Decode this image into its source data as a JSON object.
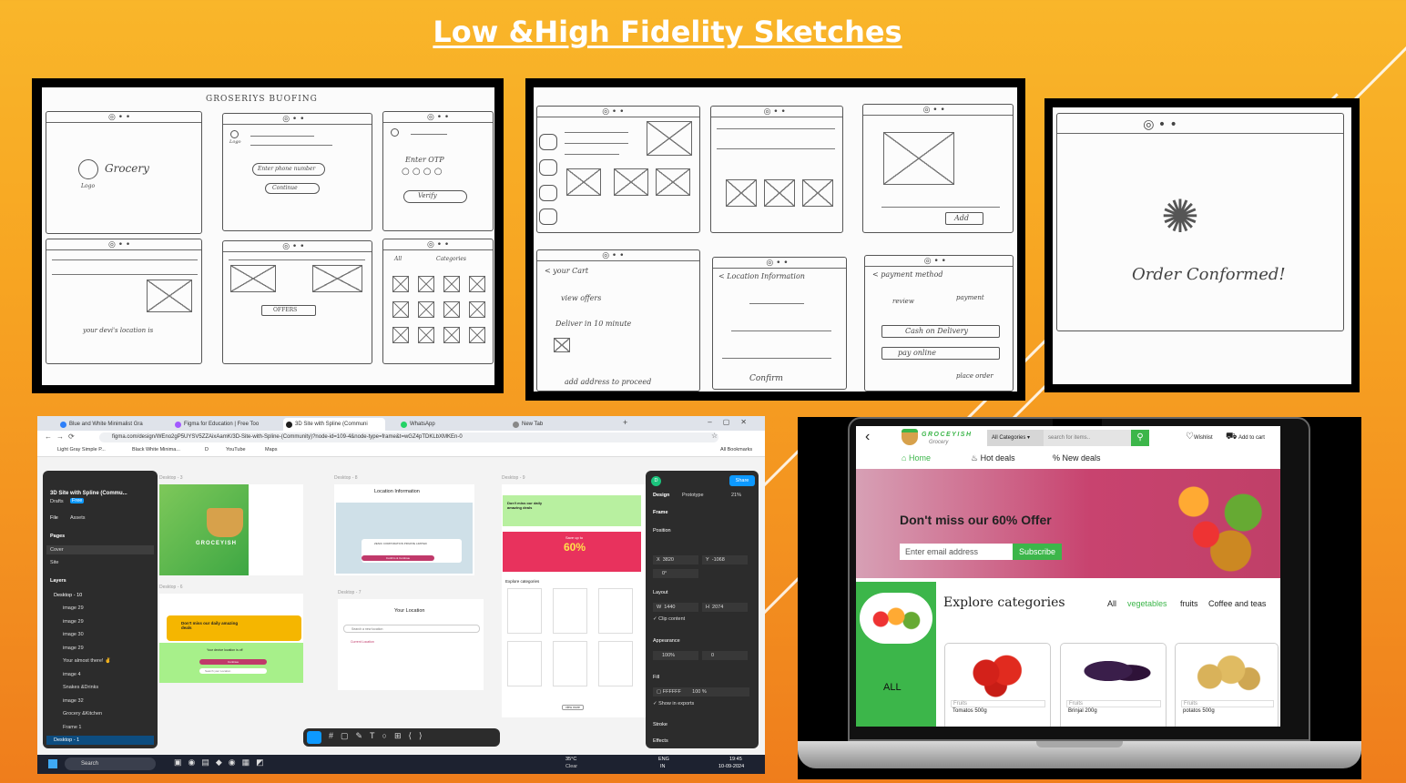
{
  "slide": {
    "title": "Low &High Fidelity Sketches"
  },
  "sketch1": {
    "header": "GROSERIYS BUOFING",
    "grocery": "Grocery",
    "logo": "Logo",
    "logo2": "Logo",
    "phone": "Enter phone number",
    "continue": "Continue",
    "otp": "Enter OTP",
    "verify": "Verify",
    "offers": "OFFERS",
    "location": "your devi's location is",
    "all": "All",
    "categories": "Categories"
  },
  "sketch2": {
    "your_cart": "< your Cart",
    "view_offers": "view offers",
    "deliver": "Deliver in 10 minute",
    "add_address": "add address to proceed",
    "location_info": "< Location Information",
    "confirm": "Confirm",
    "add": "Add",
    "payment": "< payment method",
    "review": "review",
    "payment2": "payment",
    "cash": "Cash on Delivery",
    "pay_online": "pay online",
    "place_order": "place order"
  },
  "sketch3": {
    "order": "Order Conformed!"
  },
  "figma": {
    "tabs": [
      "Blue and White Minimalist Gra",
      "Figma for Education | Free Too",
      "3D Site with Spline (Communi",
      "WhatsApp",
      "New Tab"
    ],
    "url": "figma.com/design/WEno2gP5UYSV5ZZAixAamK/3D-Site-with-Spline-(Community)?node-id=109-4&node-type=frame&t=wGZ4pTDKLbXMKEn-0",
    "bookmarks": [
      "Light Gray Simple P...",
      "Black White Minima...",
      "D",
      "YouTube",
      "Maps"
    ],
    "all_bookmarks": "All Bookmarks",
    "file_name": "3D Site with Spline (Commu...",
    "drafts": "Drafts",
    "free": "Free",
    "file": "File",
    "assets": "Assets",
    "pages": "Pages",
    "page_items": [
      "Cover",
      "Site"
    ],
    "layers": "Layers",
    "layer_items": [
      "Desktop - 10",
      "image 29",
      "image 29",
      "image 30",
      "image 29",
      "Your almost there! ✌",
      "image 4",
      "Snakes &Drinks",
      "image 32",
      "Grocery &Kitchen",
      "Frame 1",
      "Desktop - 1"
    ],
    "design": "Design",
    "prototype": "Prototype",
    "zoom": "21%",
    "frame": "Frame",
    "position": "Position",
    "x": "3820",
    "y": "-1068",
    "rot": "0°",
    "layout": "Layout",
    "w": "1440",
    "h": "2074",
    "clip": "Clip content",
    "appearance": "Appearance",
    "opacity": "100%",
    "radius": "0",
    "fill": "Fill",
    "fill_hex": "FFFFFF",
    "fill_op": "100",
    "pct": "%",
    "show_exports": "Show in exports",
    "stroke": "Stroke",
    "effects": "Effects",
    "share": "Share",
    "user": "D",
    "frames": {
      "d3": "Desktop - 3",
      "d8": "Desktop - 8",
      "d9": "Desktop - 9",
      "d6": "Desktop - 6",
      "d7": "Desktop - 7"
    },
    "location_info": "Location Information",
    "company": "ZENIC CORPORATION PRIVATE LIMITED",
    "confirm": "Confirm & Continue",
    "your_location": "Your Location",
    "search_loc": "Search a new location",
    "current_loc": "Current Location",
    "deals": "Don't miss our daily amazing deals",
    "save": "Save up to",
    "sixty": "60%",
    "explore": "Explore categories",
    "groceyish": "GROCEYISH",
    "device_loc": "Your device location is off",
    "continue": "Continue",
    "search_location": "Search your Location",
    "view_more": "view more",
    "search": "Search",
    "taskbar": {
      "search": "Search",
      "temp": "35°C",
      "weather": "Clear",
      "lang1": "ENG",
      "lang2": "IN",
      "time": "19:45",
      "date": "10-09-2024"
    }
  },
  "app": {
    "logo": "GROCEYISH",
    "logo_sub": "Grocery",
    "categories": "All Categories",
    "search": "search for items..",
    "wishlist": "Wishlist",
    "cart": "Add to cart",
    "nav": [
      "Home",
      "Hot deals",
      "New deals"
    ],
    "offer": "Don't miss our 60% Offer",
    "email": "Enter email address",
    "subscribe": "Subscribe",
    "explore": "Explore categories",
    "all_label": "ALL",
    "filters": [
      "All",
      "vegetables",
      "fruits",
      "Coffee and teas"
    ],
    "products": [
      {
        "cat": "Fruits",
        "name": "Tomatos 500g"
      },
      {
        "cat": "Fruits",
        "name": "Brinjal 200g"
      },
      {
        "cat": "Fruits",
        "name": "potatos 500g"
      }
    ],
    "colors": {
      "green": "#3cb64a",
      "banner": "#c8436f",
      "accent": "#e94b8a"
    }
  }
}
